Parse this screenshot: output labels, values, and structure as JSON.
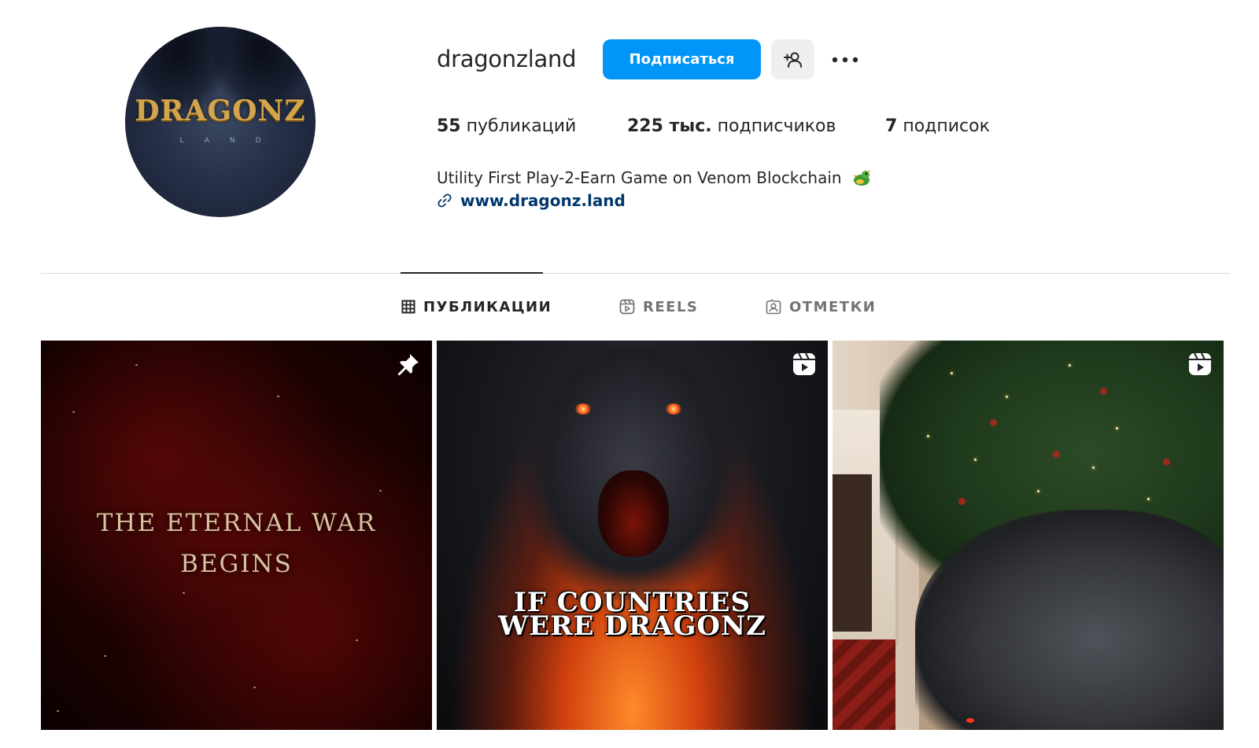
{
  "profile": {
    "avatar_logo": "DRAGONZ",
    "avatar_logo_sub": "LAND",
    "username": "dragonzland",
    "follow_label": "Подписаться",
    "stats": {
      "posts_count": "55",
      "posts_label": "публикаций",
      "followers_count": "225 тыс.",
      "followers_label": "подписчиков",
      "following_count": "7",
      "following_label": "подписок"
    },
    "bio": "Utility First Play-2-Earn Game on Venom Blockchain",
    "link": "www.dragonz.land"
  },
  "tabs": [
    {
      "label": "ПУБЛИКАЦИИ",
      "icon": "grid-icon",
      "active": true
    },
    {
      "label": "REELS",
      "icon": "reels-icon",
      "active": false
    },
    {
      "label": "ОТМЕТКИ",
      "icon": "tagged-icon",
      "active": false
    }
  ],
  "posts": [
    {
      "type": "pinned",
      "icon": "pin-icon",
      "overlay_text_line1": "THE ETERNAL WAR",
      "overlay_text_line2": "BEGINS"
    },
    {
      "type": "reel",
      "icon": "reel-icon",
      "overlay_text_line1": "IF COUNTRIES",
      "overlay_text_line2": "WERE DRAGONZ"
    },
    {
      "type": "reel",
      "icon": "reel-icon",
      "overlay_text_line1": "",
      "overlay_text_line2": ""
    }
  ],
  "colors": {
    "follow_button": "#0095f6",
    "secondary_button": "#efefef",
    "link": "#00376b",
    "divider": "#dbdbdb"
  }
}
